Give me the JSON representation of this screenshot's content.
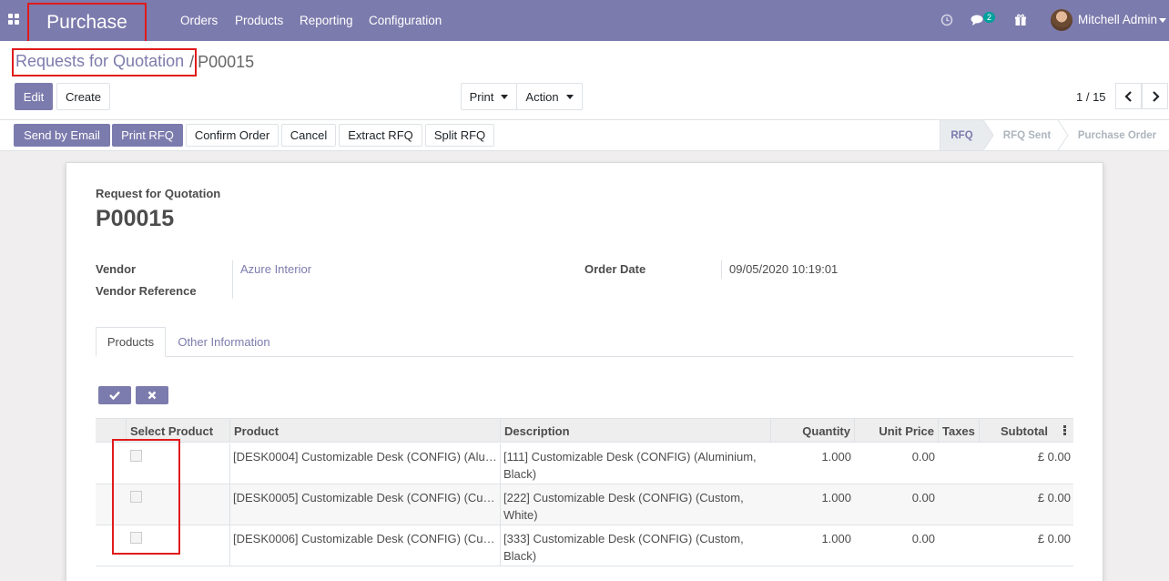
{
  "navbar": {
    "app_name": "Purchase",
    "menu": [
      "Orders",
      "Products",
      "Reporting",
      "Configuration"
    ],
    "messages_badge": "2",
    "user_name": "Mitchell Admin",
    "icons": [
      "apps-icon",
      "clock-icon",
      "chat-icon",
      "gift-icon"
    ]
  },
  "breadcrumb": {
    "parent": "Requests for Quotation",
    "separator": "/",
    "current": "P00015"
  },
  "controls": {
    "edit": "Edit",
    "create": "Create",
    "print": "Print",
    "action": "Action",
    "pager": "1 / 15"
  },
  "statusbar": {
    "buttons": [
      "Send by Email",
      "Print RFQ",
      "Confirm Order",
      "Cancel",
      "Extract RFQ",
      "Split RFQ"
    ],
    "stages": [
      "RFQ",
      "RFQ Sent",
      "Purchase Order"
    ],
    "active_stage": "RFQ"
  },
  "form": {
    "doc_type": "Request for Quotation",
    "name": "P00015",
    "vendor_label": "Vendor",
    "vendor_value": "Azure Interior",
    "vendor_ref_label": "Vendor Reference",
    "vendor_ref_value": "",
    "order_date_label": "Order Date",
    "order_date_value": "09/05/2020 10:19:01"
  },
  "tabs": [
    "Products",
    "Other Information"
  ],
  "table": {
    "headers": [
      "Select Product",
      "Product",
      "Description",
      "Quantity",
      "Unit Price",
      "Taxes",
      "Subtotal"
    ],
    "rows": [
      {
        "product": "[DESK0004] Customizable Desk (CONFIG) (Alu…",
        "description": "[111] Customizable Desk (CONFIG) (Aluminium, Black)",
        "quantity": "1.000",
        "unit_price": "0.00",
        "taxes": "",
        "subtotal": "£ 0.00"
      },
      {
        "product": "[DESK0005] Customizable Desk (CONFIG) (Cu…",
        "description": "[222] Customizable Desk (CONFIG) (Custom, White)",
        "quantity": "1.000",
        "unit_price": "0.00",
        "taxes": "",
        "subtotal": "£ 0.00"
      },
      {
        "product": "[DESK0006] Customizable Desk (CONFIG) (Cu…",
        "description": "[333] Customizable Desk (CONFIG) (Custom, Black)",
        "quantity": "1.000",
        "unit_price": "0.00",
        "taxes": "",
        "subtotal": "£ 0.00"
      }
    ]
  },
  "colors": {
    "brand": "#7c7bad",
    "highlight": "#e01b1b"
  }
}
